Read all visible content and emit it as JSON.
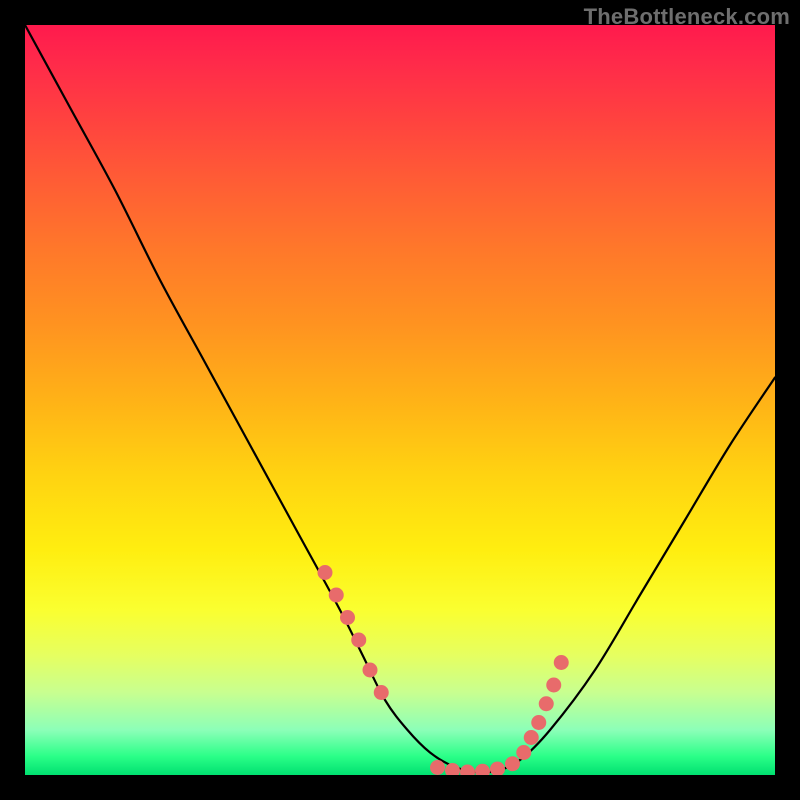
{
  "watermark": "TheBottleneck.com",
  "chart_data": {
    "type": "line",
    "title": "",
    "xlabel": "",
    "ylabel": "",
    "xlim": [
      0,
      100
    ],
    "ylim": [
      0,
      100
    ],
    "grid": false,
    "series": [
      {
        "name": "curve",
        "x": [
          0,
          6,
          12,
          18,
          24,
          30,
          36,
          42,
          45,
          48,
          51,
          54,
          57,
          60,
          63,
          66,
          70,
          76,
          82,
          88,
          94,
          100
        ],
        "y": [
          100,
          89,
          78,
          66,
          55,
          44,
          33,
          22,
          16,
          10,
          6,
          3,
          1.2,
          0.4,
          0.6,
          2,
          6,
          14,
          24,
          34,
          44,
          53
        ]
      }
    ],
    "markers": {
      "name": "highlight-dots",
      "color": "#e86b6b",
      "points_x": [
        40,
        41.5,
        43,
        44.5,
        46,
        47.5,
        55,
        57,
        59,
        61,
        63,
        65,
        66.5,
        67.5,
        68.5,
        69.5,
        70.5,
        71.5
      ],
      "points_y": [
        27,
        24,
        21,
        18,
        14,
        11,
        1,
        0.6,
        0.4,
        0.5,
        0.8,
        1.5,
        3,
        5,
        7,
        9.5,
        12,
        15
      ]
    }
  }
}
